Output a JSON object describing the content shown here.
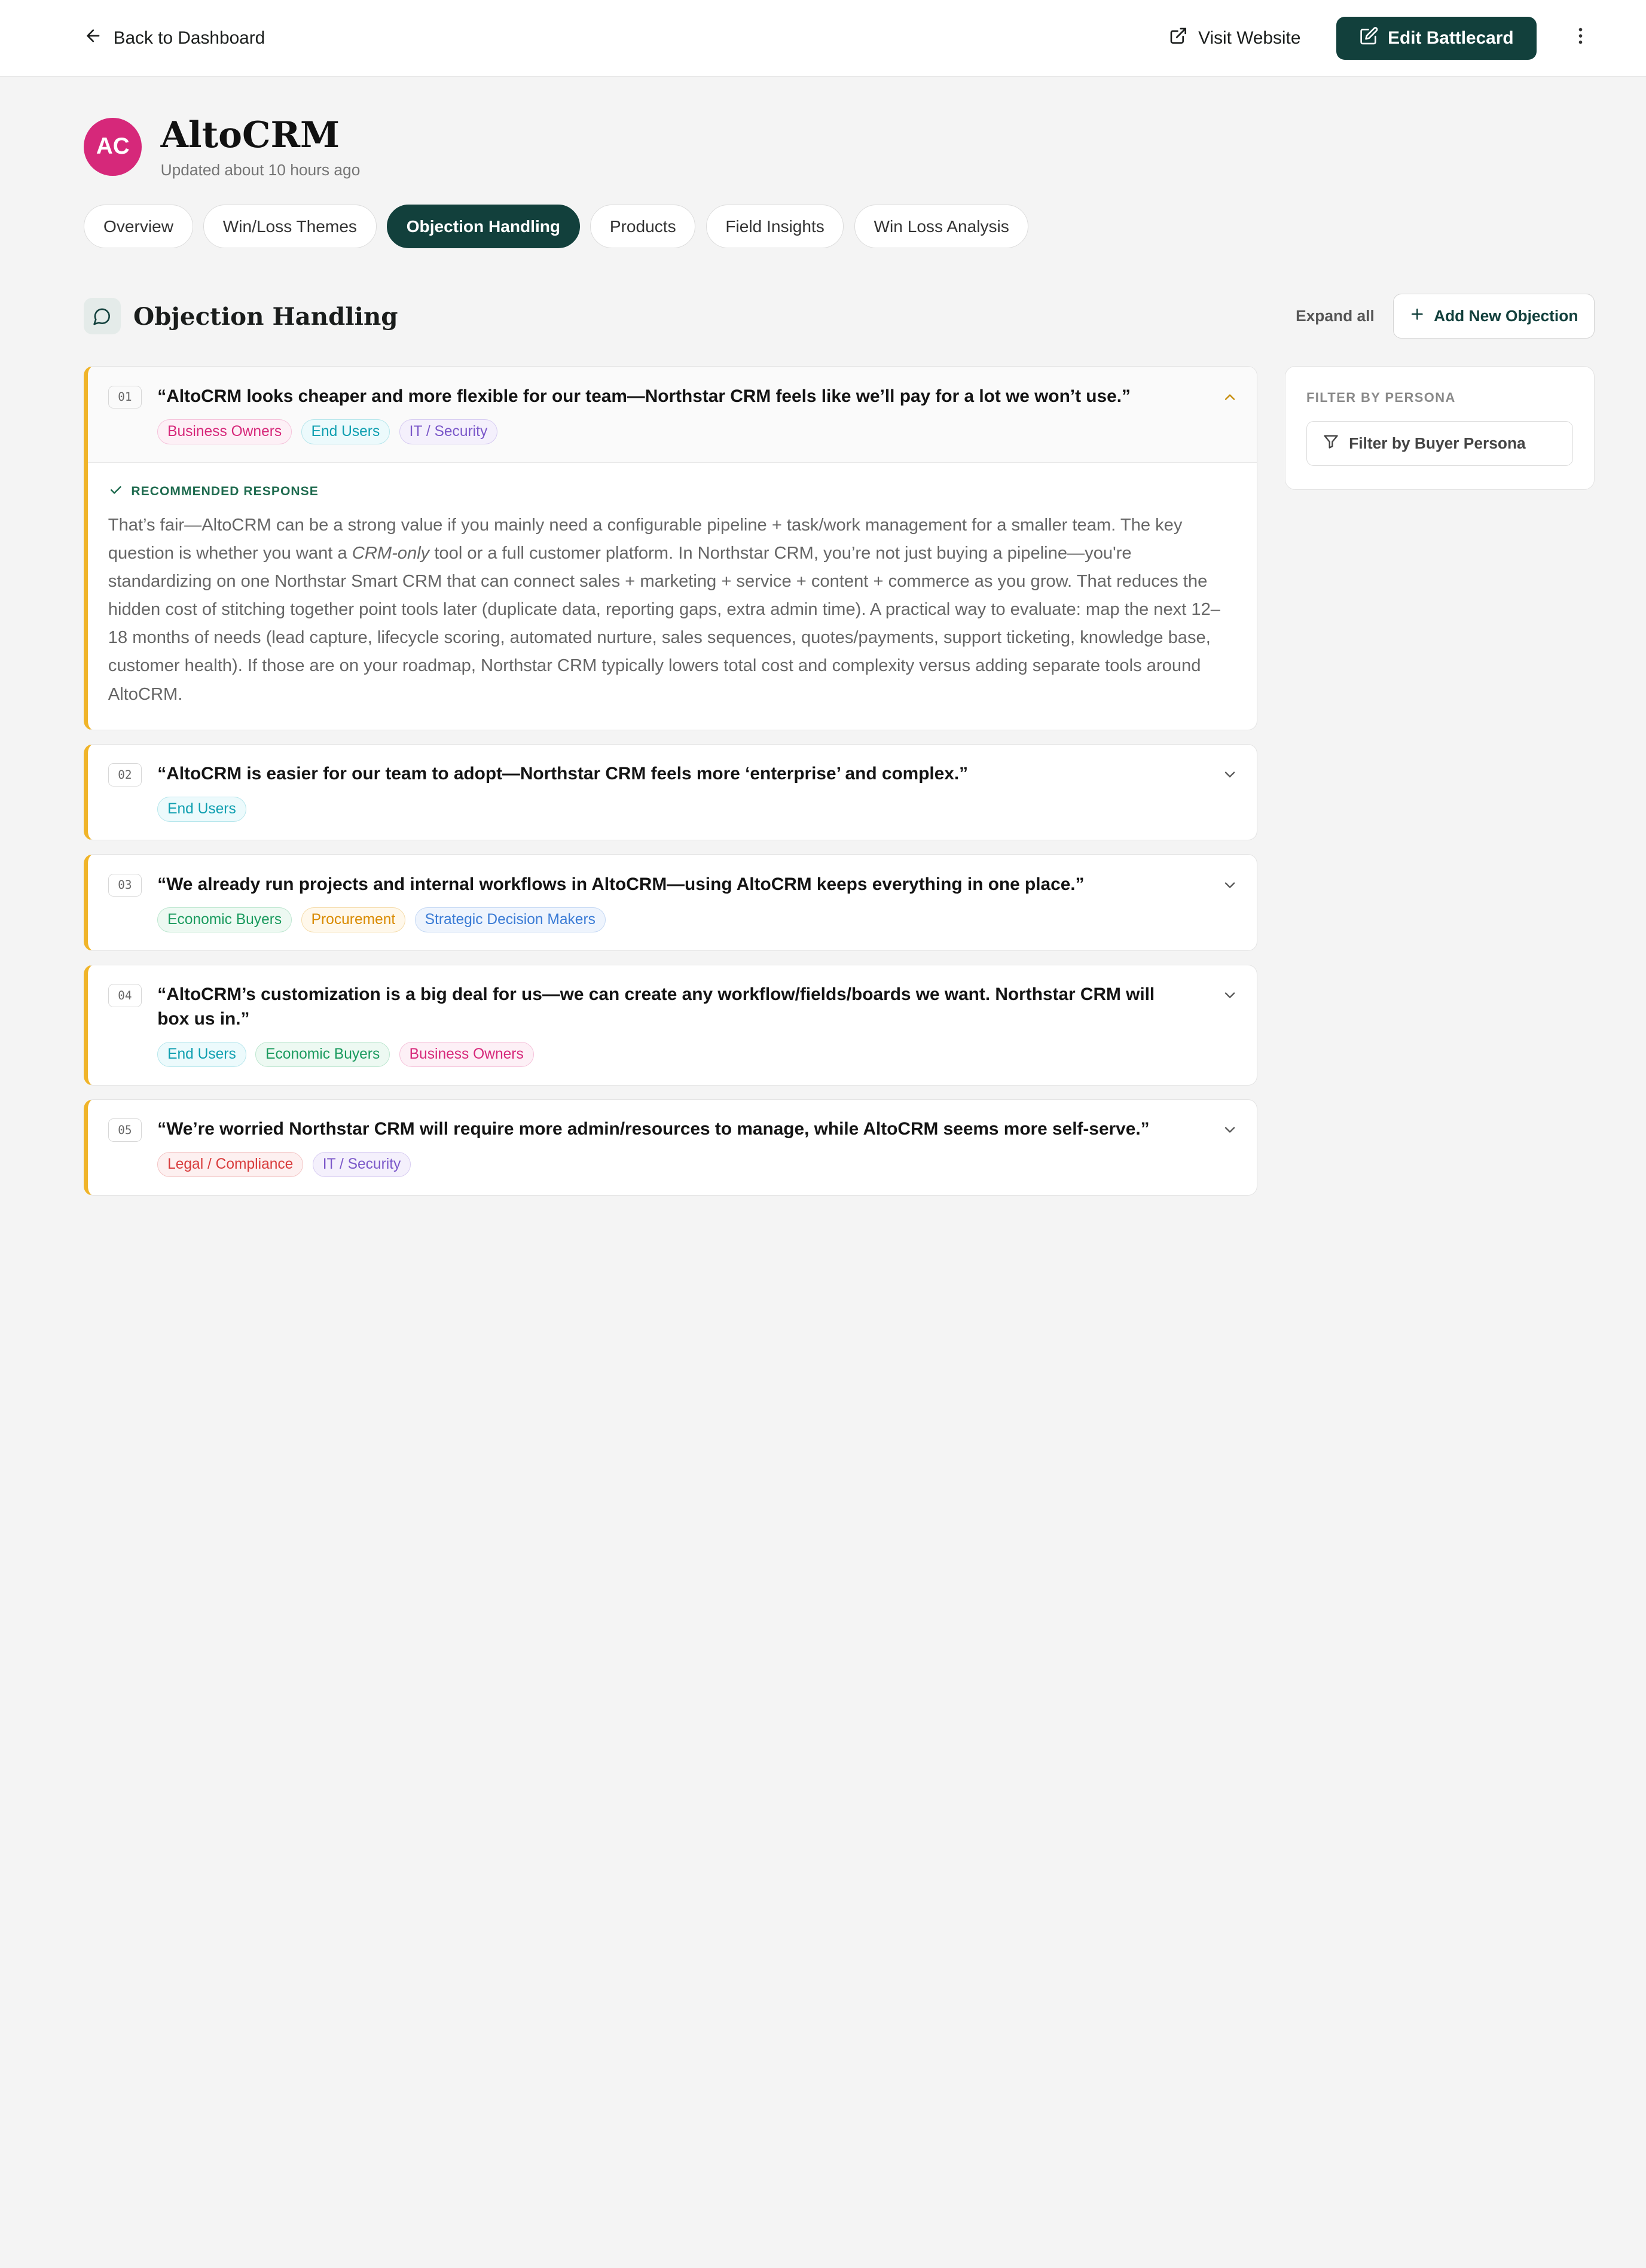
{
  "topbar": {
    "back_label": "Back to Dashboard",
    "visit_label": "Visit Website",
    "edit_label": "Edit Battlecard"
  },
  "company": {
    "initials": "AC",
    "name": "AltoCRM",
    "updated": "Updated about 10 hours ago",
    "avatar_color": "#d6287a"
  },
  "tabs": [
    {
      "label": "Overview",
      "active": false
    },
    {
      "label": "Win/Loss Themes",
      "active": false
    },
    {
      "label": "Objection Handling",
      "active": true
    },
    {
      "label": "Products",
      "active": false
    },
    {
      "label": "Field Insights",
      "active": false
    },
    {
      "label": "Win Loss Analysis",
      "active": false
    }
  ],
  "section": {
    "title": "Objection Handling",
    "expand_all": "Expand all",
    "add_label": "Add New Objection"
  },
  "objections": [
    {
      "num": "01",
      "text": "“AltoCRM looks cheaper and more flexible for our team—Northstar CRM feels like we’ll pay for a lot we won’t use.”",
      "tags": [
        "Business Owners",
        "End Users",
        "IT / Security"
      ],
      "expanded": true,
      "response_label": "RECOMMENDED RESPONSE",
      "response_pre": "That’s fair—AltoCRM can be a strong value if you mainly need a configurable pipeline + task/work management for a smaller team. The key question is whether you want a ",
      "response_em": "CRM-only",
      "response_post": " tool or a full customer platform. In Northstar CRM, you’re not just buying a pipeline—you're standardizing on one Northstar Smart CRM that can connect sales + marketing + service + content + commerce as you grow. That reduces the hidden cost of stitching together point tools later (duplicate data, reporting gaps, extra admin time). A practical way to evaluate: map the next 12–18 months of needs (lead capture, lifecycle scoring, automated nurture, sales sequences, quotes/payments, support ticketing, knowledge base, customer health). If those are on your roadmap, Northstar CRM typically lowers total cost and complexity versus adding separate tools around AltoCRM."
    },
    {
      "num": "02",
      "text": "“AltoCRM is easier for our team to adopt—Northstar CRM feels more ‘enterprise’ and complex.”",
      "tags": [
        "End Users"
      ],
      "expanded": false
    },
    {
      "num": "03",
      "text": "“We already run projects and internal workflows in AltoCRM—using AltoCRM keeps everything in one place.”",
      "tags": [
        "Economic Buyers",
        "Procurement",
        "Strategic Decision Makers"
      ],
      "expanded": false
    },
    {
      "num": "04",
      "text": "“AltoCRM’s customization is a big deal for us—we can create any workflow/fields/boards we want. Northstar CRM will box us in.”",
      "tags": [
        "End Users",
        "Economic Buyers",
        "Business Owners"
      ],
      "expanded": false
    },
    {
      "num": "05",
      "text": "“We’re worried Northstar CRM will require more admin/resources to manage, while AltoCRM seems more self-serve.”",
      "tags": [
        "Legal / Compliance",
        "IT / Security"
      ],
      "expanded": false
    }
  ],
  "tag_colors": {
    "Business Owners": {
      "fg": "#d6287a",
      "bg": "#fdf0f6",
      "border": "#f5c2da"
    },
    "End Users": {
      "fg": "#0f9fb0",
      "bg": "#ecfafc",
      "border": "#b6e6ec"
    },
    "IT / Security": {
      "fg": "#7b58c9",
      "bg": "#f4f0fc",
      "border": "#d7ccf2"
    },
    "Economic Buyers": {
      "fg": "#1a9a5e",
      "bg": "#edf9f2",
      "border": "#bce6cf"
    },
    "Procurement": {
      "fg": "#d98a00",
      "bg": "#fff8eb",
      "border": "#f5dcaa"
    },
    "Strategic Decision Makers": {
      "fg": "#3a7bd5",
      "bg": "#eef4fd",
      "border": "#c4d8f4"
    },
    "Legal / Compliance": {
      "fg": "#d83b3b",
      "bg": "#fdf0f0",
      "border": "#f3c4c4"
    }
  },
  "filter": {
    "label": "FILTER BY PERSONA",
    "placeholder": "Filter by Buyer Persona"
  },
  "colors": {
    "accent": "#12403c",
    "card_border_left": "#f0b429"
  }
}
